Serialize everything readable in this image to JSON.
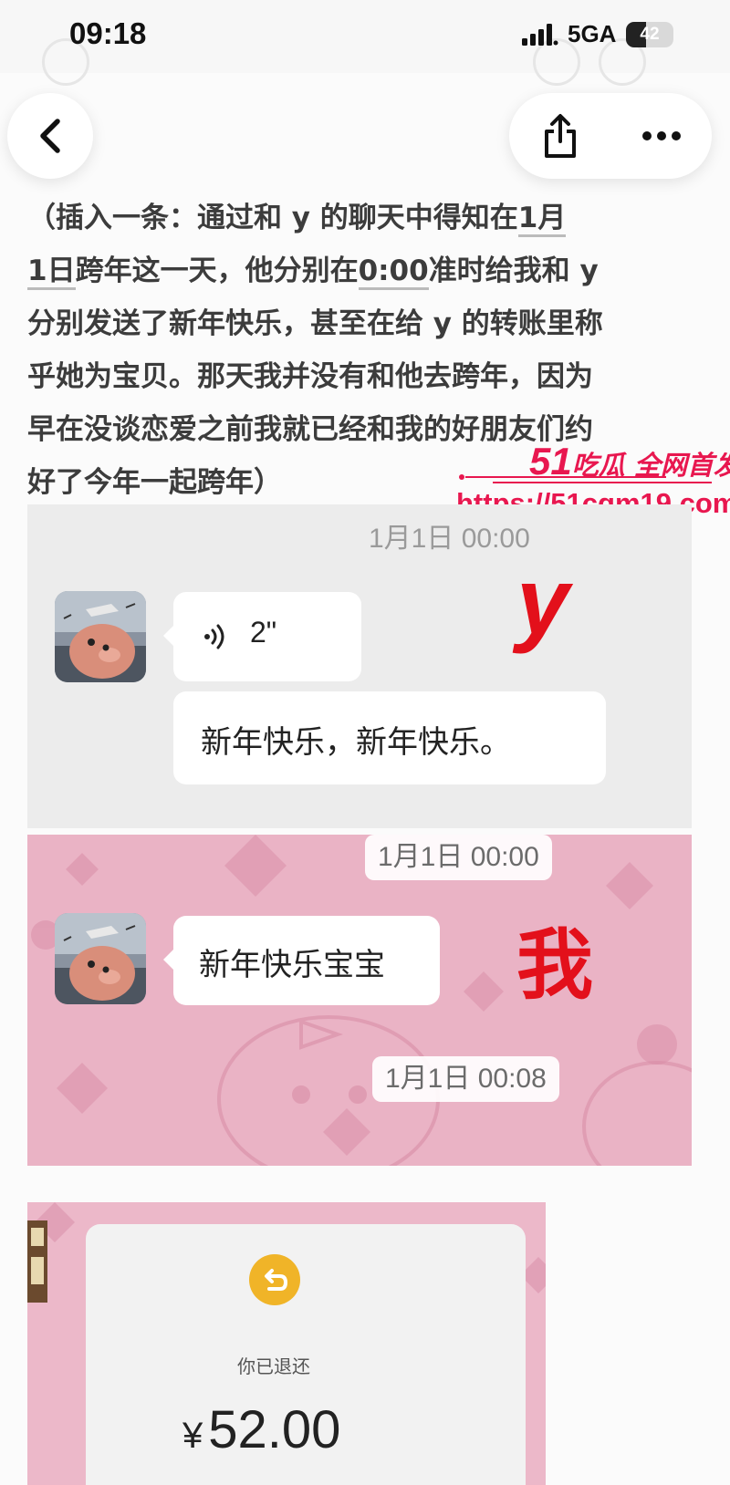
{
  "status_bar": {
    "time": "09:18",
    "network": "5GA",
    "battery": "42",
    "battery_level": 0.42
  },
  "nav": {
    "back_icon": "chevron-left-icon",
    "share_icon": "share-icon",
    "more_icon": "more-icon"
  },
  "article": {
    "lines": [
      [
        "（插入一条：通过和 y 的聊天中得知在",
        {
          "u": "1月"
        }
      ],
      [
        {
          "u": "1日"
        },
        "跨年这一天，他分别在",
        {
          "u": "0:00"
        },
        "准时给我和 y"
      ],
      [
        "分别发送了新年快乐，甚至在给 y 的转账里称"
      ],
      [
        "乎她为宝贝。那天我并没有和他去跨年，因为"
      ],
      [
        "早在没谈恋爱之前我就已经和我的好朋友们约"
      ],
      [
        "好了今年一起跨年）"
      ]
    ]
  },
  "watermark": {
    "brand_number": "51",
    "brand_text": "吃瓜 全网首发",
    "url": "https://51cgm19.com"
  },
  "chat_y": {
    "timestamp": "1月1日 00:00",
    "voice_duration": "2\"",
    "message": "新年快乐，新年快乐。",
    "annotation": "y"
  },
  "chat_me": {
    "timestamp_top": "1月1日 00:00",
    "message": "新年快乐宝宝",
    "annotation": "我",
    "timestamp_bottom": "1月1日 00:08"
  },
  "refund": {
    "label": "你已退还",
    "currency": "¥",
    "amount": "52.00"
  }
}
